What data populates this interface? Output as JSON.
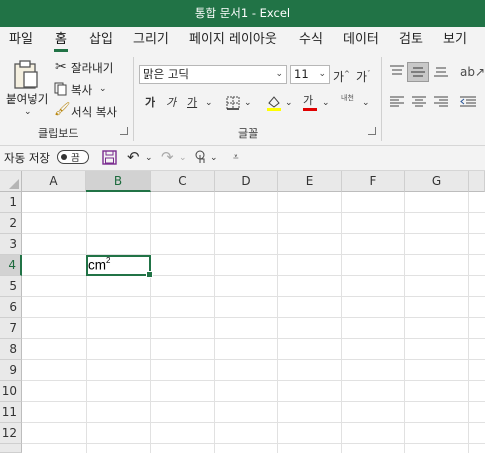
{
  "window": {
    "title": "통합 문서1  -  Excel"
  },
  "tabs": [
    "파일",
    "홈",
    "삽입",
    "그리기",
    "페이지 레이아웃",
    "수식",
    "데이터",
    "검토",
    "보기"
  ],
  "ribbon": {
    "clipboard": {
      "paste_label": "붙여넣기",
      "cut_label": "잘라내기",
      "copy_label": "복사",
      "format_painter_label": "서식 복사",
      "group_label": "클립보드"
    },
    "font": {
      "font_name": "맑은 고딕",
      "font_size": "11",
      "bold": "가",
      "italic": "가",
      "underline": "가",
      "phonetic": "내천",
      "group_label": "글꼴"
    }
  },
  "qat": {
    "autosave_label": "자동 저장",
    "autosave_state": "끔"
  },
  "sheet": {
    "columns": [
      "A",
      "B",
      "C",
      "D",
      "E",
      "F",
      "G"
    ],
    "rows": [
      "1",
      "2",
      "3",
      "4",
      "5",
      "6",
      "7",
      "8",
      "9",
      "10",
      "11",
      "12"
    ],
    "active_cell": "B4",
    "cells": {
      "B4": {
        "text": "cm",
        "superscript": "2"
      }
    }
  },
  "colors": {
    "accent": "#217346"
  }
}
